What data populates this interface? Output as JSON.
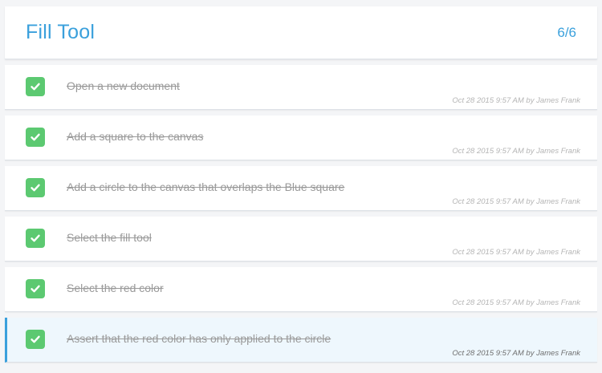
{
  "header": {
    "title": "Fill Tool",
    "progress": "6/6"
  },
  "tasks": [
    {
      "label": "Open a new document",
      "meta": "Oct 28 2015 9:57 AM by James Frank",
      "completed": true
    },
    {
      "label": "Add a square to the canvas",
      "meta": "Oct 28 2015 9:57 AM by James Frank",
      "completed": true
    },
    {
      "label": "Add a circle to the canvas that overlaps the Blue square",
      "meta": "Oct 28 2015 9:57 AM by James Frank",
      "completed": true
    },
    {
      "label": "Select the fill tool",
      "meta": "Oct 28 2015 9:57 AM by James Frank",
      "completed": true
    },
    {
      "label": "Select the red color",
      "meta": "Oct 28 2015 9:57 AM by James Frank",
      "completed": true
    },
    {
      "label": "Assert that the red color has only applied to the circle",
      "meta": "Oct 28 2015 9:57 AM by James Frank",
      "completed": true,
      "selected": true
    }
  ],
  "colors": {
    "accent": "#3aa0dc",
    "check_green": "#5cc971",
    "selected_bg": "#eef7fd"
  },
  "icons": {
    "checkbox": "checkmark-icon"
  }
}
